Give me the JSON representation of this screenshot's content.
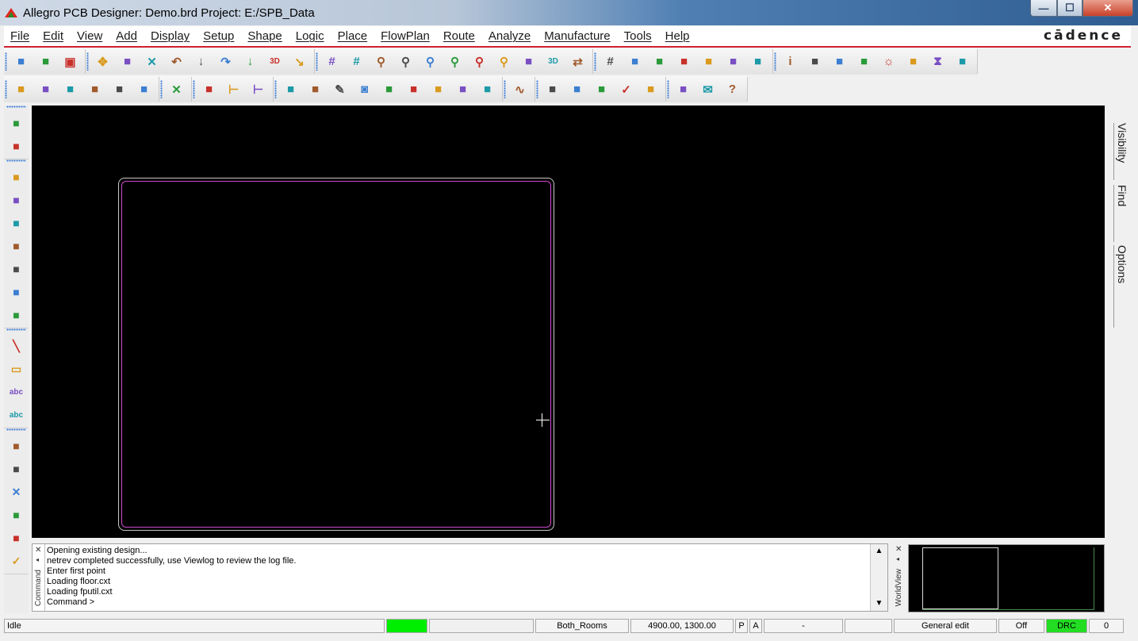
{
  "window": {
    "title": "Allegro PCB Designer: Demo.brd  Project: E:/SPB_Data",
    "min_glyph": "—",
    "max_glyph": "☐",
    "close_glyph": "✕"
  },
  "menubar": {
    "items": [
      "File",
      "Edit",
      "View",
      "Add",
      "Display",
      "Setup",
      "Shape",
      "Logic",
      "Place",
      "FlowPlan",
      "Route",
      "Analyze",
      "Manufacture",
      "Tools",
      "Help"
    ],
    "brand": "cādence",
    "accent_color": "#d2202f"
  },
  "toolbar1": {
    "groups": [
      [
        "new-file-icon",
        "open-folder-icon",
        "save-icon"
      ],
      [
        "move-icon",
        "copy-icon",
        "delete-icon",
        "undo-icon",
        "import-icon",
        "redo-icon",
        "export-icon",
        "view-3d-ball-icon",
        "pin-icon"
      ],
      [
        "grid-view-icon",
        "grid-icon",
        "zoom-fit-icon",
        "zoom-window-icon",
        "zoom-in-icon",
        "zoom-out-icon",
        "zoom-previous-icon",
        "zoom-selection-icon",
        "redraw-icon",
        "3d-view-icon",
        "flip-icon"
      ],
      [
        "grid-toggle-icon",
        "color-icon",
        "layer-visibility-icon",
        "layers-icon",
        "film-icon",
        "table-icon",
        "board-icon"
      ],
      [
        "info-icon",
        "property-icon",
        "measure-icon",
        "eraser-icon",
        "sun-icon",
        "bulb-icon",
        "hourglass-icon",
        "stop-icon"
      ]
    ]
  },
  "toolbar2": {
    "groups": [
      [
        "shape-add-icon",
        "shape-edit-icon",
        "shape-merge-icon",
        "shape-void-icon",
        "shape-select-icon",
        "shape-disabled-icon"
      ],
      [
        "delete-unplaced-icon"
      ],
      [
        "component-icon",
        "dimension-icon",
        "dimension-linear-icon"
      ],
      [
        "odb-icon",
        "artwork-icon",
        "wrench-icon",
        "camera-icon",
        "refdes-icon",
        "documentation-icon",
        "drill-icon",
        "testpoint-icon",
        "array-icon"
      ],
      [
        "route-icon"
      ],
      [
        "report-icon",
        "gloss-icon",
        "database-icon",
        "check-icon",
        "edit-icon"
      ],
      [
        "window-icon",
        "mail-icon",
        "help-icon"
      ]
    ]
  },
  "leftbar": {
    "groups": [
      [
        "place-manual-icon",
        "place-quick-icon"
      ],
      [
        "add-connect-icon",
        "slide-icon",
        "delay-tune-icon",
        "fanout-icon",
        "spread-icon",
        "bus-icon",
        "phase-tune-icon"
      ],
      [
        "add-line-icon",
        "add-rect-icon",
        "add-text-icon",
        "edit-text-icon"
      ],
      [
        "custom-smooth-icon",
        "vertex-icon",
        "delete-vertex-icon",
        "via-icon",
        "shape-cutout-icon",
        "shape-check-icon"
      ]
    ]
  },
  "right_panel": {
    "tabs": [
      "Visibility",
      "Find",
      "Options"
    ]
  },
  "command": {
    "side_label": "Command",
    "lines": [
      "Opening existing design...",
      "netrev completed successfully, use Viewlog to review the log file.",
      "Enter first point",
      "Loading floor.cxt",
      "Loading fputil.cxt",
      "Command >"
    ],
    "scroll_up": "▲",
    "scroll_down": "▼"
  },
  "worldview": {
    "side_label": "WorldView"
  },
  "status": {
    "state": "Idle",
    "rooms": "Both_Rooms",
    "coords": "4900.00, 1300.00",
    "p": "P",
    "a": "A",
    "dash": "-",
    "mode": "General edit",
    "off": "Off",
    "drc": "DRC",
    "count": "0",
    "busy_color": "#00ee00",
    "drc_color": "#22dd22"
  }
}
